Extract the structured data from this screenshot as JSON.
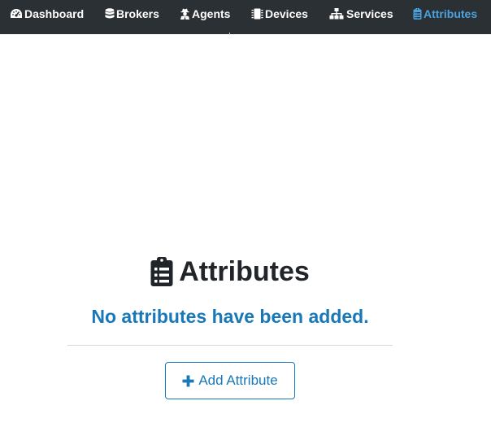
{
  "nav": {
    "items": [
      {
        "label": "Dashboard",
        "icon": "tachometer-icon",
        "active": false
      },
      {
        "label": "Brokers",
        "icon": "database-icon",
        "active": false
      },
      {
        "label": "Agents",
        "icon": "user-secret-icon",
        "active": false
      },
      {
        "label": "Devices",
        "icon": "microchip-icon",
        "active": false
      },
      {
        "label": "Services",
        "icon": "sitemap-icon",
        "active": false
      },
      {
        "label": "Attributes",
        "icon": "clipboard-list-icon",
        "active": true
      }
    ]
  },
  "colors": {
    "navbar_bg": "#2b3034",
    "active": "#4aa3df",
    "primary": "#1878b8",
    "heading": "#212529"
  },
  "main": {
    "title": "Attributes",
    "title_icon": "clipboard-list-icon",
    "empty_message": "No attributes have been added.",
    "add_button_label": "Add Attribute",
    "add_button_icon": "plus-icon"
  }
}
